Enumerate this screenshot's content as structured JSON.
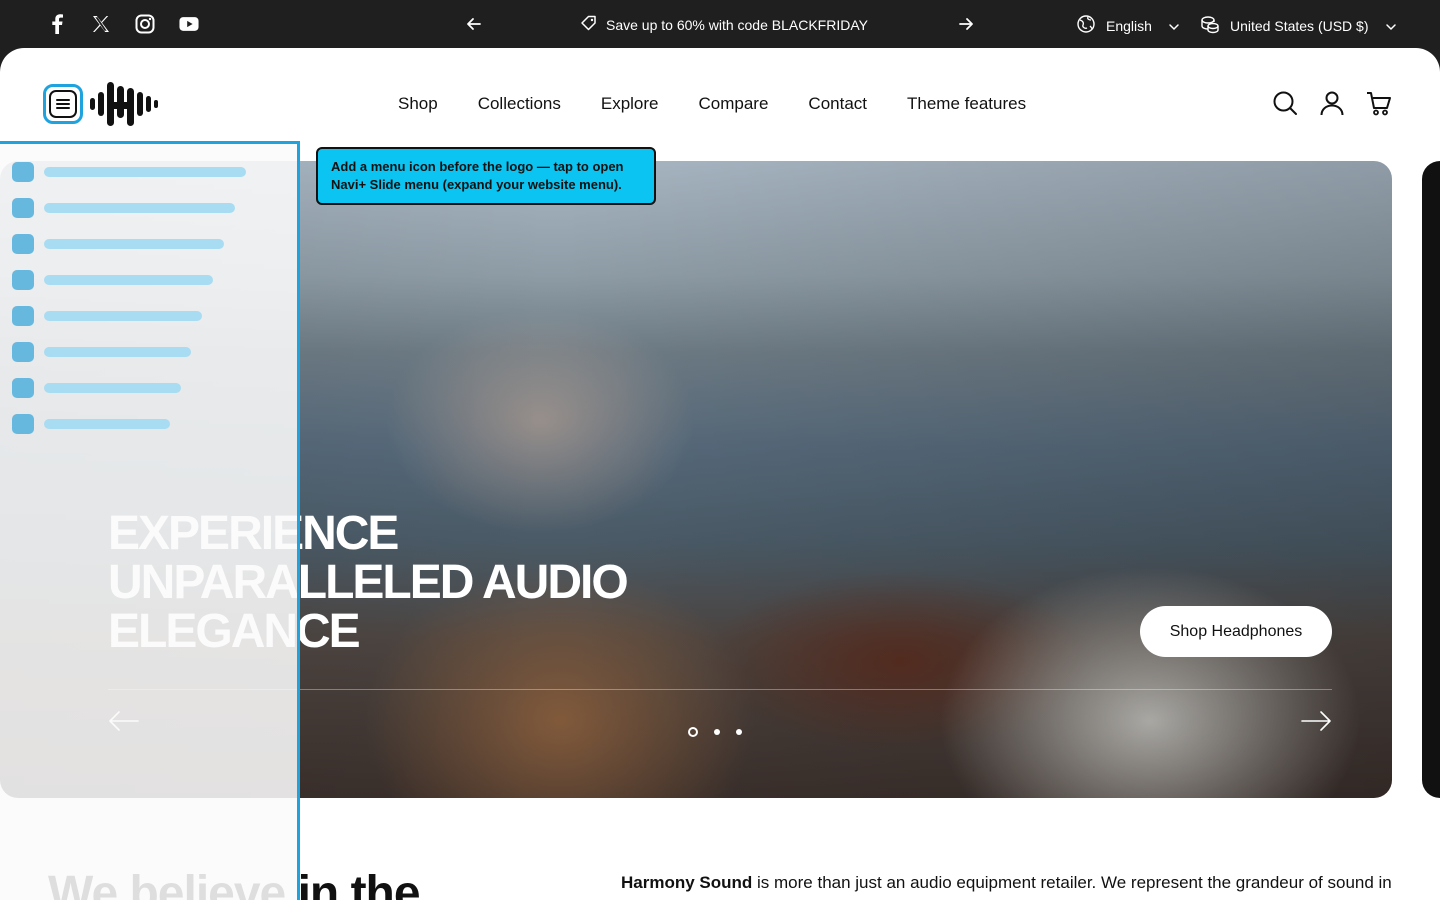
{
  "topbar": {
    "social": [
      {
        "name": "facebook-icon"
      },
      {
        "name": "x-icon"
      },
      {
        "name": "instagram-icon"
      },
      {
        "name": "youtube-icon"
      }
    ],
    "announcement": "Save up to 60% with code BLACKFRIDAY",
    "language": "English",
    "currency": "United States (USD $)"
  },
  "header": {
    "nav": [
      "Shop",
      "Collections",
      "Explore",
      "Compare",
      "Contact",
      "Theme features"
    ]
  },
  "slide_menu": {
    "item_count": 8,
    "icon_color": "#67b8df",
    "bar_color": "#a8dcf2",
    "accent": "#1fa3df"
  },
  "tooltip": {
    "text": "Add a menu icon before the logo — tap to open Navi+ Slide menu (expand your website menu)."
  },
  "hero": {
    "title": "EXPERIENCE UNPARALLELED AUDIO ELEGANCE",
    "cta": "Shop Headphones",
    "active_slide": 1,
    "slide_count": 3
  },
  "content": {
    "heading": "We believe in the",
    "brand": "Harmony Sound",
    "intro": " is more than just an audio equipment retailer. We represent the grandeur of sound in"
  }
}
